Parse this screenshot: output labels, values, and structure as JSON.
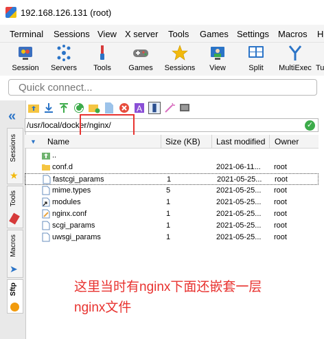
{
  "window": {
    "title": "192.168.126.131 (root)"
  },
  "menu": [
    "Terminal",
    "Sessions",
    "View",
    "X server",
    "Tools",
    "Games",
    "Settings",
    "Macros",
    "H"
  ],
  "toolbar": {
    "session": "Session",
    "servers": "Servers",
    "tools": "Tools",
    "games": "Games",
    "sessions": "Sessions",
    "view": "View",
    "split": "Split",
    "multiexec": "MultiExec",
    "tu": "Tu"
  },
  "quick_connect": {
    "placeholder": "Quick connect..."
  },
  "side_tabs": {
    "sessions": "Sessions",
    "tools": "Tools",
    "macros": "Macros",
    "sftp": "Sftp"
  },
  "path": "/usr/local/docker/nginx/",
  "table": {
    "headers": {
      "name": "Name",
      "size": "Size (KB)",
      "modified": "Last modified",
      "owner": "Owner"
    },
    "rows": [
      {
        "name": "..",
        "size": "",
        "modified": "",
        "owner": "",
        "type": "up"
      },
      {
        "name": "conf.d",
        "size": "",
        "modified": "2021-06-11...",
        "owner": "root",
        "type": "folder"
      },
      {
        "name": "fastcgi_params",
        "size": "1",
        "modified": "2021-05-25...",
        "owner": "root",
        "type": "file"
      },
      {
        "name": "mime.types",
        "size": "5",
        "modified": "2021-05-25...",
        "owner": "root",
        "type": "file"
      },
      {
        "name": "modules",
        "size": "1",
        "modified": "2021-05-25...",
        "owner": "root",
        "type": "link"
      },
      {
        "name": "nginx.conf",
        "size": "1",
        "modified": "2021-05-25...",
        "owner": "root",
        "type": "conf"
      },
      {
        "name": "scgi_params",
        "size": "1",
        "modified": "2021-05-25...",
        "owner": "root",
        "type": "file"
      },
      {
        "name": "uwsgi_params",
        "size": "1",
        "modified": "2021-05-25...",
        "owner": "root",
        "type": "file"
      }
    ]
  },
  "annotation": {
    "line1": "这里当时有nginx下面还嵌套一层",
    "line2": "nginx文件"
  },
  "colors": {
    "annotation": "#e8322f",
    "accent": "#2b74c7"
  }
}
